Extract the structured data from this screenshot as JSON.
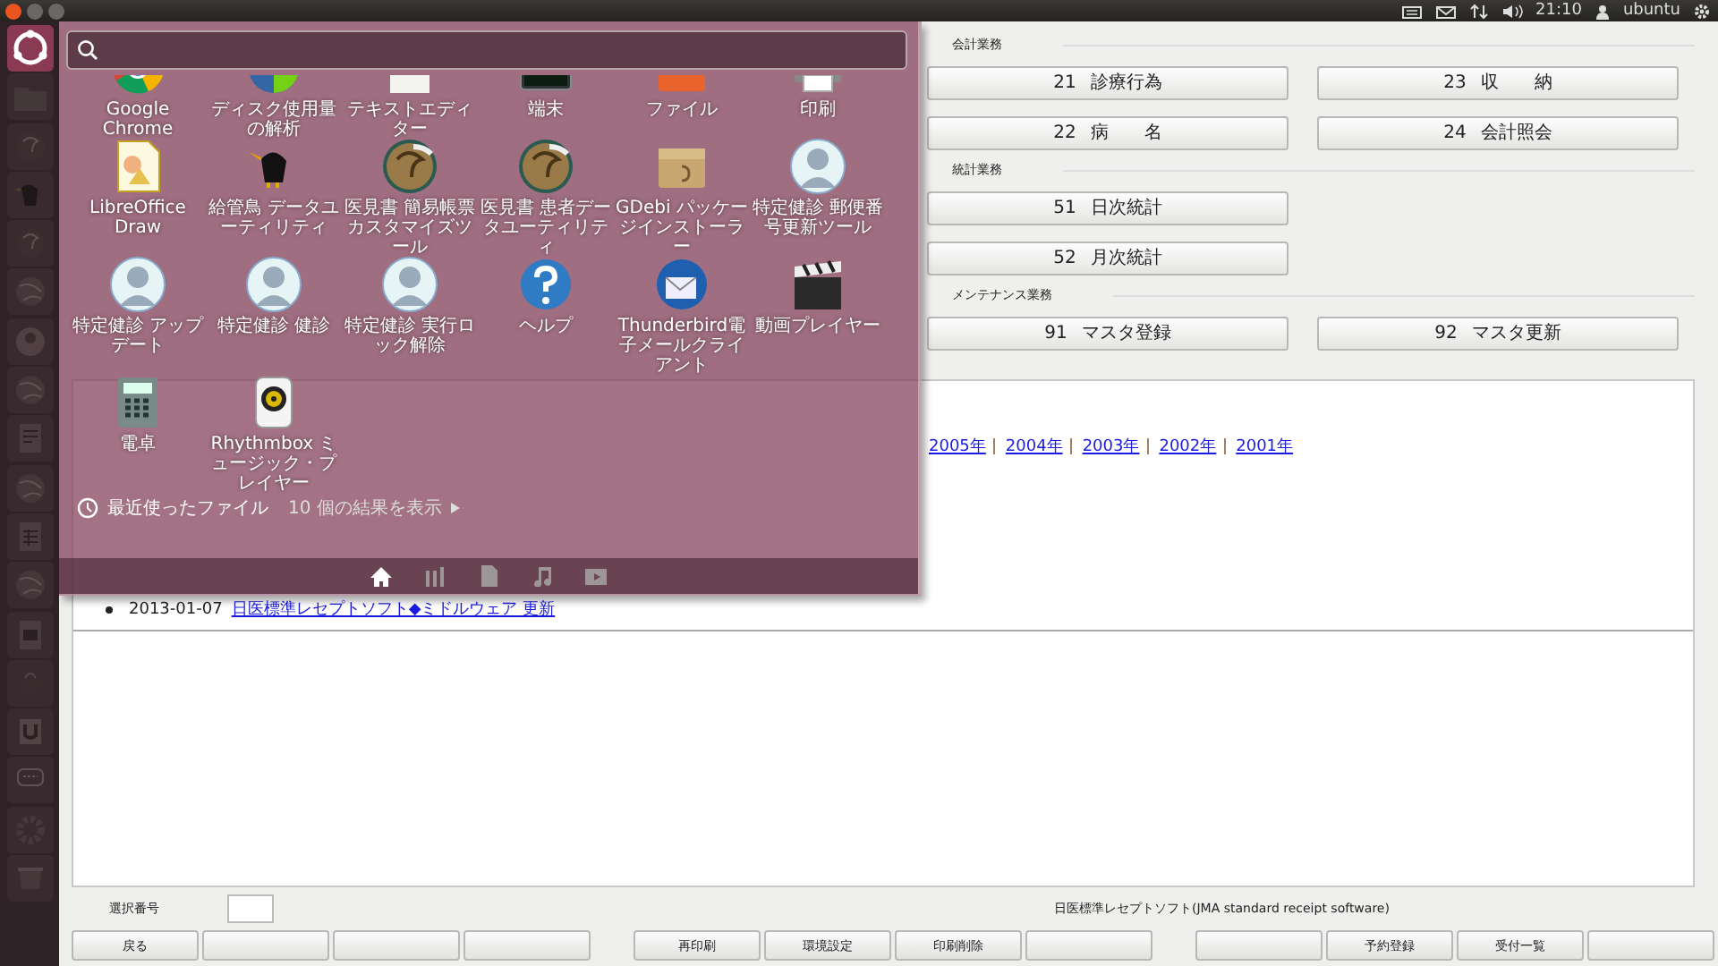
{
  "top_panel": {
    "clock": "21:10",
    "user": "ubuntu"
  },
  "launcher": [
    {
      "kind": "dash",
      "selected": true
    },
    {
      "kind": "folder",
      "selected": false
    },
    {
      "kind": "gecko",
      "selected": false
    },
    {
      "kind": "bird",
      "selected": false
    },
    {
      "kind": "gecko",
      "selected": false
    },
    {
      "kind": "globe",
      "selected": false
    },
    {
      "kind": "person",
      "selected": false
    },
    {
      "kind": "globe",
      "selected": false
    },
    {
      "kind": "document",
      "selected": false
    },
    {
      "kind": "globe",
      "selected": false
    },
    {
      "kind": "spreadsheet",
      "selected": false
    },
    {
      "kind": "globe",
      "selected": false
    },
    {
      "kind": "presentation",
      "selected": false
    },
    {
      "kind": "bag",
      "selected": false
    },
    {
      "kind": "store",
      "selected": false
    },
    {
      "kind": "workspaces",
      "selected": false
    },
    {
      "kind": "settings",
      "selected": false
    },
    {
      "kind": "trash",
      "selected": false
    }
  ],
  "dash": {
    "apps": [
      {
        "label": "Google Chrome",
        "kind": "browser"
      },
      {
        "label": "ディスク使用量の解析",
        "kind": "chart"
      },
      {
        "label": "テキストエディター",
        "kind": "editor"
      },
      {
        "label": "端末",
        "kind": "terminal"
      },
      {
        "label": "ファイル",
        "kind": "files"
      },
      {
        "label": "印刷",
        "kind": "printer"
      },
      {
        "label": "LibreOffice Draw",
        "kind": "drawing"
      },
      {
        "label": "給管鳥 データユーティリティ",
        "kind": "bird"
      },
      {
        "label": "医見書 簡易帳票カスタマイズツール",
        "kind": "gecko"
      },
      {
        "label": "医見書 患者データユーティリティ",
        "kind": "gecko"
      },
      {
        "label": "GDebi パッケージインストーラー",
        "kind": "package"
      },
      {
        "label": "特定健診 郵便番号更新ツール",
        "kind": "person"
      },
      {
        "label": "特定健診 アップデート",
        "kind": "person"
      },
      {
        "label": "特定健診 健診",
        "kind": "person"
      },
      {
        "label": "特定健診 実行ロック解除",
        "kind": "person"
      },
      {
        "label": "ヘルプ",
        "kind": "help"
      },
      {
        "label": "Thunderbird電子メールクライアント",
        "kind": "mail"
      },
      {
        "label": "動画プレイヤー",
        "kind": "video"
      },
      {
        "label": "電卓",
        "kind": "calculator"
      },
      {
        "label": "Rhythmbox ミュージック・プレイヤー",
        "kind": "music"
      }
    ],
    "recent": {
      "title": "最近使ったファイル",
      "more": "10 個の結果を表示"
    },
    "lenses": [
      {
        "kind": "home",
        "selected": true
      },
      {
        "kind": "apps",
        "selected": false
      },
      {
        "kind": "files",
        "selected": false
      },
      {
        "kind": "music",
        "selected": false
      },
      {
        "kind": "video",
        "selected": false
      }
    ]
  },
  "sections": [
    {
      "title": "会計業務",
      "rows": [
        [
          {
            "number": "21",
            "label": "診療行為"
          },
          {
            "number": "23",
            "label": "収　　納"
          }
        ],
        [
          {
            "number": "22",
            "label": "病　　名"
          },
          {
            "number": "24",
            "label": "会計照会"
          }
        ]
      ]
    },
    {
      "title": "統計業務",
      "rows": [
        [
          {
            "number": "51",
            "label": "日次統計"
          }
        ],
        [
          {
            "number": "52",
            "label": "月次統計"
          }
        ]
      ]
    },
    {
      "title": "メンテナンス業務",
      "rows": [
        [
          {
            "number": "91",
            "label": "マスタ登録"
          },
          {
            "number": "92",
            "label": "マスタ更新"
          }
        ]
      ]
    }
  ],
  "web": {
    "year_links": [
      "2005年",
      "2004年",
      "2003年",
      "2002年",
      "2001年"
    ],
    "news": [
      {
        "date": "2013-01-07",
        "link": "日医標準レセプトソフト◆ミドルウェア 更新"
      }
    ]
  },
  "footer": {
    "select_label": "選択番号",
    "product": "日医標準レセプトソフト(JMA standard receipt software)",
    "function_keys": [
      [
        {
          "kind": "labeled",
          "label": "戻る"
        },
        {
          "kind": "blank"
        },
        {
          "kind": "blank"
        },
        {
          "kind": "blank"
        }
      ],
      [
        {
          "kind": "labeled",
          "label": "再印刷"
        },
        {
          "kind": "labeled",
          "label": "環境設定"
        },
        {
          "kind": "labeled",
          "label": "印刷削除"
        },
        {
          "kind": "blank"
        }
      ],
      [
        {
          "kind": "blank"
        },
        {
          "kind": "labeled",
          "label": "予約登録"
        },
        {
          "kind": "labeled",
          "label": "受付一覧"
        },
        {
          "kind": "blank"
        }
      ]
    ]
  }
}
